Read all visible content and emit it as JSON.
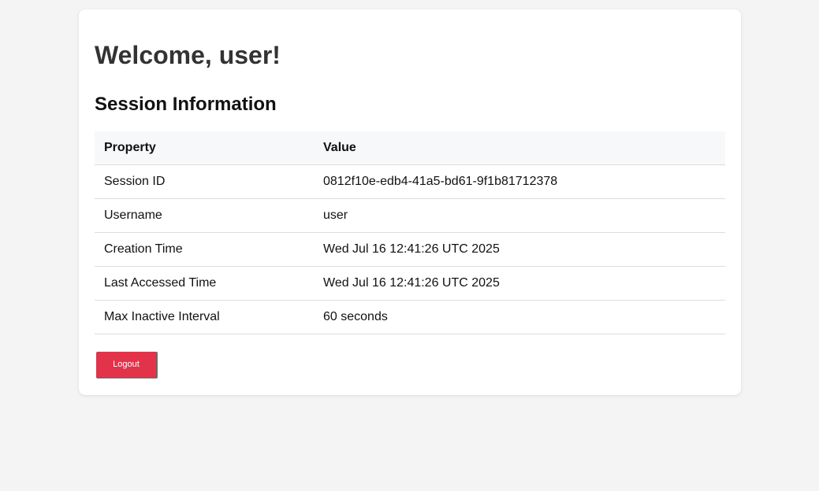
{
  "page": {
    "welcome_heading": "Welcome, user!",
    "section_title": "Session Information"
  },
  "table": {
    "headers": [
      "Property",
      "Value"
    ],
    "rows": [
      {
        "property": "Session ID",
        "value": "0812f10e-edb4-41a5-bd61-9f1b81712378"
      },
      {
        "property": "Username",
        "value": "user"
      },
      {
        "property": "Creation Time",
        "value": "Wed Jul 16 12:41:26 UTC 2025"
      },
      {
        "property": "Last Accessed Time",
        "value": "Wed Jul 16 12:41:26 UTC 2025"
      },
      {
        "property": "Max Inactive Interval",
        "value": "60 seconds"
      }
    ]
  },
  "actions": {
    "logout_label": "Logout"
  },
  "colors": {
    "page_background": "#f4f4f4",
    "card_background": "#ffffff",
    "header_row_background": "#f7f8fa",
    "logout_button": "#e3334a",
    "heading_text": "#333333"
  }
}
